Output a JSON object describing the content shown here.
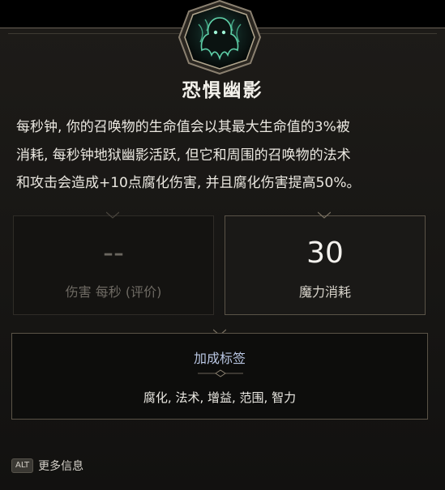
{
  "skill": {
    "icon": "ghost-specter-icon",
    "name": "恐惧幽影",
    "description": "每秒钟, 你的召唤物的生命值会以其最大生命值的3%被\n消耗, 每秒钟地狱幽影活跃, 但它和周围的召唤物的法术\n和攻击会造成+10点腐化伤害, 并且腐化伤害提高50%。"
  },
  "stats": {
    "dps_value": "--",
    "dps_label": "伤害 每秒 (评价)",
    "mana_value": "30",
    "mana_label": "魔力消耗"
  },
  "tags": {
    "title": "加成标签",
    "list": "腐化, 法术, 增益, 范围, 智力"
  },
  "footer": {
    "key_label": "ALT",
    "more_info": "更多信息"
  },
  "colors": {
    "title": "#f2f0ea",
    "tags_title": "#b9c6e3",
    "frame": "#5a5347",
    "icon_glow": "#5fd0a8"
  }
}
